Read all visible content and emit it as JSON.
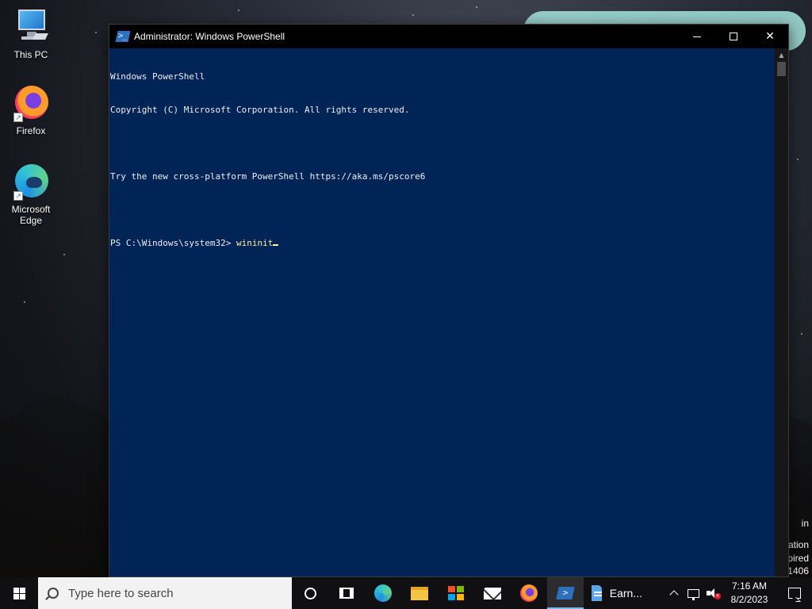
{
  "desktop": {
    "icons": [
      {
        "label": "This PC",
        "icon": "this-pc-icon"
      },
      {
        "label": "Firefox",
        "icon": "firefox-icon"
      },
      {
        "label": "Microsoft Edge",
        "icon": "edge-icon"
      }
    ],
    "background_text": [
      "in",
      "ation",
      "pired",
      "1406"
    ]
  },
  "window": {
    "title": "Administrator: Windows PowerShell",
    "title_icon": "powershell-icon",
    "controls": {
      "minimize": "minimize-icon",
      "maximize": "maximize-icon",
      "close": "close-icon"
    },
    "console": {
      "lines": [
        "Windows PowerShell",
        "Copyright (C) Microsoft Corporation. All rights reserved.",
        "",
        "Try the new cross-platform PowerShell https://aka.ms/pscore6",
        ""
      ],
      "prompt": "PS C:\\Windows\\system32> ",
      "command": "wininit"
    },
    "colors": {
      "console_bg": "#012456",
      "text": "#eeedf0",
      "command": "#f9f1a5"
    }
  },
  "taskbar": {
    "search_placeholder": "Type here to search",
    "apps": [
      {
        "name": "cortana",
        "icon": "cortana-icon"
      },
      {
        "name": "task-view",
        "icon": "task-view-icon"
      },
      {
        "name": "edge",
        "icon": "edge-icon"
      },
      {
        "name": "file-explorer",
        "icon": "folder-icon"
      },
      {
        "name": "store",
        "icon": "store-icon"
      },
      {
        "name": "mail",
        "icon": "mail-icon"
      },
      {
        "name": "firefox",
        "icon": "firefox-icon"
      },
      {
        "name": "powershell",
        "icon": "powershell-icon",
        "active": true
      }
    ],
    "open_app_label": "Earn...",
    "tray": {
      "time": "7:16 AM",
      "date": "8/2/2023"
    }
  }
}
